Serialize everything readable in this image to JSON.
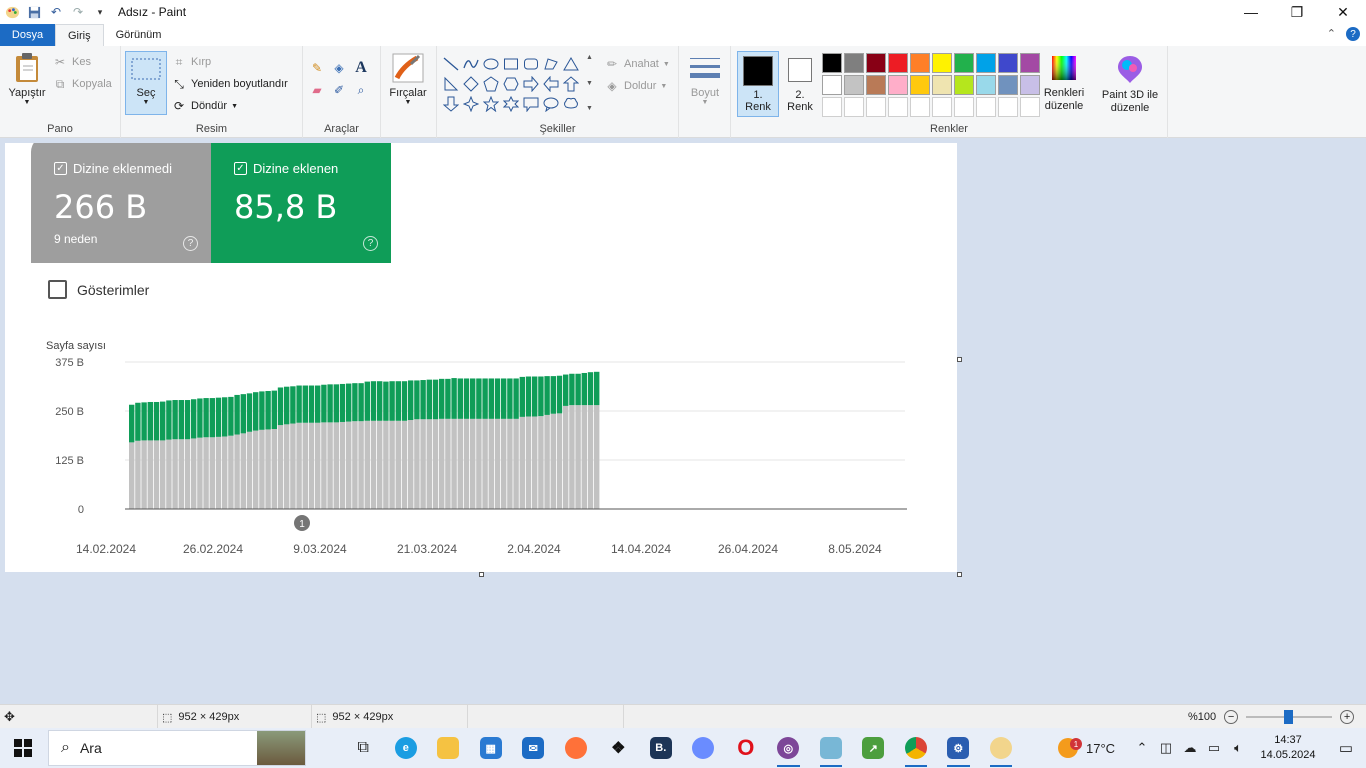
{
  "window": {
    "title": "Adsız - Paint"
  },
  "menu": {
    "tabs": [
      "Dosya",
      "Giriş",
      "Görünüm"
    ]
  },
  "ribbon": {
    "pano": {
      "label": "Pano",
      "paste": "Yapıştır",
      "cut": "Kes",
      "copy": "Kopyala"
    },
    "resim": {
      "label": "Resim",
      "select": "Seç",
      "crop": "Kırp",
      "resize": "Yeniden boyutlandır",
      "rotate": "Döndür"
    },
    "araclar": {
      "label": "Araçlar"
    },
    "brushes": {
      "label": "Fırçalar"
    },
    "sekiller": {
      "label": "Şekiller",
      "outline": "Anahat",
      "fill": "Doldur"
    },
    "size": {
      "label": "Boyut"
    },
    "colors": {
      "label": "Renkler",
      "color1": "1. Renk",
      "color2": "2. Renk",
      "edit": "Renkleri düzenle",
      "paint3d": "Paint 3D ile düzenle",
      "palette": [
        "#000000",
        "#7f7f7f",
        "#880015",
        "#ed1c24",
        "#ff7f27",
        "#fff200",
        "#22b14c",
        "#00a2e8",
        "#3f48cc",
        "#a349a4",
        "#ffffff",
        "#c3c3c3",
        "#b97a57",
        "#ffaec9",
        "#ffc90e",
        "#efe4b0",
        "#b5e61d",
        "#99d9ea",
        "#7092be",
        "#c8bfe7",
        "#ffffff",
        "#ffffff",
        "#ffffff",
        "#ffffff",
        "#ffffff",
        "#ffffff",
        "#ffffff",
        "#ffffff",
        "#ffffff",
        "#ffffff"
      ]
    }
  },
  "report": {
    "not_indexed": {
      "label": "Dizine eklenmedi",
      "value": "266 B",
      "sub": "9 neden"
    },
    "indexed": {
      "label": "Dizine eklenen",
      "value": "85,8 B"
    },
    "impressions_label": "Gösterimler",
    "annotation": "1"
  },
  "chart_data": {
    "type": "bar",
    "stacked": true,
    "ylabel": "Sayfa sayısı",
    "ylim": [
      0,
      375000
    ],
    "yticks": [
      "0",
      "125 B",
      "250 B",
      "375 B"
    ],
    "xticks": [
      "14.02.2024",
      "26.02.2024",
      "9.03.2024",
      "21.03.2024",
      "2.04.2024",
      "14.04.2024",
      "26.04.2024",
      "8.05.2024"
    ],
    "colors": {
      "not_indexed": "#c2c2c2",
      "indexed": "#0f9d58"
    },
    "series": [
      {
        "key": "not_indexed",
        "values": [
          170,
          174,
          175,
          175,
          175,
          175,
          177,
          178,
          178,
          178,
          180,
          182,
          183,
          183,
          184,
          185,
          187,
          190,
          193,
          197,
          200,
          202,
          203,
          204,
          214,
          216,
          218,
          220,
          220,
          220,
          220,
          221,
          221,
          221,
          222,
          223,
          224,
          224,
          225,
          225,
          225,
          225,
          225,
          225,
          225,
          227,
          229,
          229,
          229,
          229,
          230,
          230,
          230,
          230,
          230,
          230,
          230,
          230,
          230,
          230,
          230,
          230,
          230,
          235,
          236,
          236,
          237,
          240,
          243,
          244,
          263,
          265,
          265,
          265,
          265,
          265
        ]
      },
      {
        "key": "indexed",
        "values": [
          96,
          97,
          97,
          98,
          98,
          99,
          100,
          100,
          100,
          100,
          100,
          100,
          100,
          100,
          100,
          100,
          99,
          101,
          100,
          98,
          98,
          98,
          98,
          98,
          96,
          96,
          95,
          95,
          95,
          95,
          95,
          96,
          97,
          97,
          97,
          97,
          97,
          97,
          100,
          101,
          101,
          100,
          101,
          101,
          101,
          101,
          99,
          100,
          101,
          101,
          102,
          102,
          104,
          103,
          103,
          103,
          103,
          103,
          103,
          103,
          103,
          103,
          103,
          102,
          102,
          102,
          101,
          99,
          96,
          96,
          80,
          80,
          80,
          82,
          84,
          85
        ]
      }
    ]
  },
  "statusbar": {
    "selection_size": "952 × 429px",
    "image_size": "952 × 429px",
    "zoom": "%100"
  },
  "taskbar": {
    "search_placeholder": "Ara",
    "weather": "17°C",
    "weather_badge": "1",
    "time": "14:37",
    "date": "14.05.2024"
  }
}
